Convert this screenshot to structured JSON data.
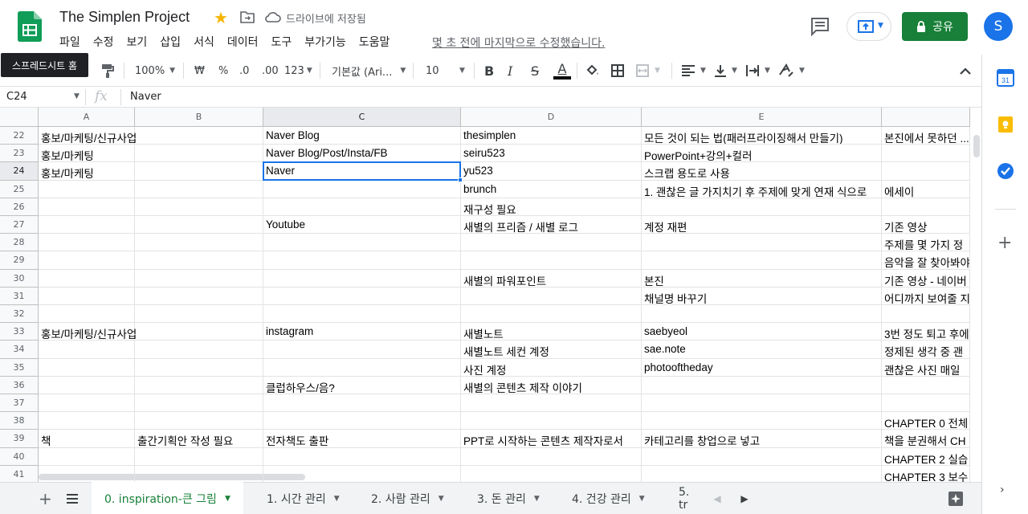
{
  "doc": {
    "title": "The Simplen Project",
    "save_status": "드라이브에 저장됨",
    "last_edit": "몇 초 전에 마지막으로 수정했습니다."
  },
  "menu": [
    "파일",
    "수정",
    "보기",
    "삽입",
    "서식",
    "데이터",
    "도구",
    "부가기능",
    "도움말"
  ],
  "tooltip": "스프레드시트 홈",
  "share_label": "공유",
  "avatar_letter": "S",
  "toolbar": {
    "zoom": "100%",
    "currency": "₩",
    "percent": "%",
    "dec_decrease": ".0",
    "dec_increase": ".00",
    "more_formats": "123",
    "font": "기본값 (Ari...",
    "font_size": "10",
    "bold": "B",
    "italic": "I",
    "strike": "S",
    "text_color_letter": "A"
  },
  "formula_bar": {
    "cell_ref": "C24",
    "fx": "fx",
    "value": "Naver"
  },
  "columns": [
    "A",
    "B",
    "C",
    "D",
    "E"
  ],
  "rows": [
    {
      "n": "22",
      "A": "홍보/마케팅/신규사업",
      "B": "",
      "C": "Naver Blog",
      "D": "thesimplen",
      "E": "모든 것이 되는 법(패러프라이징해서 만들기)",
      "F": "본진에서 못하던 ..."
    },
    {
      "n": "23",
      "A": "홍보/마케팅",
      "B": "",
      "C": "Naver Blog/Post/Insta/FB",
      "D": "seiru523",
      "E": "PowerPoint+강의+컬러",
      "F": ""
    },
    {
      "n": "24",
      "A": "홍보/마케팅",
      "B": "",
      "C": "Naver",
      "D": "yu523",
      "E": "스크랩 용도로 사용",
      "F": ""
    },
    {
      "n": "25",
      "A": "",
      "B": "",
      "C": "",
      "D": "brunch",
      "E": "1. 괜찮은 글 가지치기 후 주제에 맞게 연재 식으로",
      "F": "에세이"
    },
    {
      "n": "26",
      "A": "",
      "B": "",
      "C": "",
      "D": "재구성 필요",
      "E": "",
      "F": ""
    },
    {
      "n": "27",
      "A": "",
      "B": "",
      "C": "Youtube",
      "D": "새별의 프리즘 / 새별 로그",
      "E": "계정 재편",
      "F": "기존 영상"
    },
    {
      "n": "28",
      "A": "",
      "B": "",
      "C": "",
      "D": "",
      "E": "",
      "F": "주제를 몇 가지 정"
    },
    {
      "n": "29",
      "A": "",
      "B": "",
      "C": "",
      "D": "",
      "E": "",
      "F": "음악을 잘 찾아봐야"
    },
    {
      "n": "30",
      "A": "",
      "B": "",
      "C": "",
      "D": "새별의 파워포인트",
      "E": "본진",
      "F": "기존 영상 - 네이버"
    },
    {
      "n": "31",
      "A": "",
      "B": "",
      "C": "",
      "D": "",
      "E": "채널명 바꾸기",
      "F": "어디까지 보여줄 지"
    },
    {
      "n": "32",
      "A": "",
      "B": "",
      "C": "",
      "D": "",
      "E": "",
      "F": ""
    },
    {
      "n": "33",
      "A": "홍보/마케팅/신규사업",
      "B": "",
      "C": "instagram",
      "D": "새별노트",
      "E": "saebyeol",
      "F": "3번 정도 퇴고 후에"
    },
    {
      "n": "34",
      "A": "",
      "B": "",
      "C": "",
      "D": "새별노트 세컨 계정",
      "E": "sae.note",
      "F": "정제된 생각 중 괜"
    },
    {
      "n": "35",
      "A": "",
      "B": "",
      "C": "",
      "D": "사진 계정",
      "E": "photooftheday",
      "F": "괜찮은 사진 매일"
    },
    {
      "n": "36",
      "A": "",
      "B": "",
      "C": "클럽하우스/음?",
      "D": "새별의 콘텐츠 제작 이야기",
      "E": "",
      "F": ""
    },
    {
      "n": "37",
      "A": "",
      "B": "",
      "C": "",
      "D": "",
      "E": "",
      "F": ""
    },
    {
      "n": "38",
      "A": "",
      "B": "",
      "C": "",
      "D": "",
      "E": "",
      "F": "CHAPTER 0 전체"
    },
    {
      "n": "39",
      "A": "책",
      "B": "출간기획안 작성 필요",
      "C": "전자책도 출판",
      "D": "PPT로 시작하는 콘텐츠 제작자로서",
      "E": "카테고리를 창업으로 넣고",
      "F": "책을 분권해서 CH"
    },
    {
      "n": "40",
      "A": "",
      "B": "",
      "C": "",
      "D": "",
      "E": "",
      "F": "CHAPTER 2 실습"
    },
    {
      "n": "41",
      "A": "",
      "B": "",
      "C": "",
      "D": "",
      "E": "",
      "F": "CHAPTER 3 보수"
    }
  ],
  "sheet_tabs": [
    "0. inspiration-큰 그림",
    "1. 시간 관리",
    "2. 사람 관리",
    "3. 돈 관리",
    "4. 건강 관리",
    "5. tr"
  ],
  "colors": {
    "sheets_green": "#0f9d58",
    "share_green": "#188038",
    "selection_blue": "#1a73e8",
    "star_yellow": "#f4b400"
  }
}
